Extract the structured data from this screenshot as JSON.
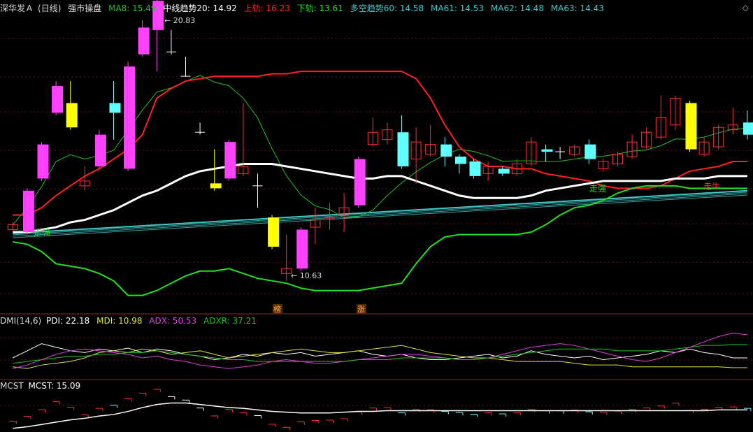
{
  "header": {
    "stock": "深华发Ａ",
    "period": "(日线)",
    "indicator": "强市操盘",
    "ma8": "MA8: 15.49",
    "mid": "中线趋势20: 14.92",
    "upper": "上轨: 16.23",
    "lower": "下轨: 13.61",
    "long": "多空趋势60: 14.58",
    "ma61": "MA61: 14.53",
    "ma62": "MA62: 14.48",
    "ma63": "MA63: 14.43"
  },
  "dmi_header": {
    "name": "DMI(14,6)",
    "pdi": "PDI: 22.18",
    "mdi": "MDI: 10.98",
    "adx": "ADX: 50.53",
    "adxr": "ADXR: 37.21"
  },
  "mcst_header": {
    "name": "MCST",
    "value": "MCST: 15.09"
  },
  "colors": {
    "upper_band": "#ff2020",
    "lower_band": "#20e020",
    "mid_line": "#ffffff",
    "ma8": "#20c020",
    "ma6x": "#40c8c8",
    "bull_candle": "#ff40ff",
    "yellow_candle": "#ffff00",
    "cyan_candle": "#60ffff",
    "red_candle": "#ff3030",
    "pdi": "#ffffff",
    "mdi": "#e0e040",
    "adx": "#e040e0",
    "adxr": "#20c020"
  },
  "annotations": {
    "high_price": "20.83",
    "low_price": "10.63",
    "signal_1": "走强",
    "signal_2": "走强",
    "signal_3": "走牛",
    "marker_1": "榜",
    "marker_2": "涨"
  },
  "chart_data": [
    {
      "type": "candlestick",
      "title": "强市操盘",
      "ylim": [
        9.5,
        21.5
      ],
      "candles": [
        {
          "o": 12.7,
          "c": 12.9,
          "h": 13.0,
          "l": 12.6,
          "s": "red"
        },
        {
          "o": 12.6,
          "c": 14.3,
          "h": 14.4,
          "l": 12.5,
          "s": "pink"
        },
        {
          "o": 14.8,
          "c": 16.2,
          "h": 16.3,
          "l": 14.7,
          "s": "pink"
        },
        {
          "o": 17.5,
          "c": 18.6,
          "h": 18.8,
          "l": 17.4,
          "s": "pink"
        },
        {
          "o": 17.9,
          "c": 16.9,
          "h": 18.8,
          "l": 16.8,
          "s": "yellow"
        },
        {
          "o": 14.5,
          "c": 14.7,
          "h": 15.3,
          "l": 14.3,
          "s": "red"
        },
        {
          "o": 15.3,
          "c": 16.6,
          "h": 16.8,
          "l": 15.2,
          "s": "pink"
        },
        {
          "o": 17.9,
          "c": 17.5,
          "h": 18.8,
          "l": 16.4,
          "s": "cyan"
        },
        {
          "o": 15.2,
          "c": 19.4,
          "h": 19.6,
          "l": 15.1,
          "s": "pink"
        },
        {
          "o": 19.9,
          "c": 21.0,
          "h": 21.3,
          "l": 19.8,
          "s": "pink"
        },
        {
          "o": 20.9,
          "c": 22.1,
          "h": 22.3,
          "l": 19.2,
          "s": "pink"
        },
        {
          "o": 20.0,
          "c": 20.0,
          "h": 20.9,
          "l": 19.9,
          "s": "doji"
        },
        {
          "o": 19.0,
          "c": 19.0,
          "h": 19.8,
          "l": 19.0,
          "s": "doji"
        },
        {
          "o": 16.7,
          "c": 16.7,
          "h": 17.1,
          "l": 16.6,
          "s": "doji"
        },
        {
          "o": 14.6,
          "c": 14.4,
          "h": 16.0,
          "l": 14.3,
          "s": "yellow"
        },
        {
          "o": 14.8,
          "c": 16.3,
          "h": 16.4,
          "l": 14.7,
          "s": "pink"
        },
        {
          "o": 15.0,
          "c": 15.3,
          "h": 17.9,
          "l": 14.9,
          "s": "red"
        },
        {
          "o": 14.5,
          "c": 14.5,
          "h": 15.0,
          "l": 13.6,
          "s": "doji"
        },
        {
          "o": 13.2,
          "c": 12.0,
          "h": 13.3,
          "l": 11.9,
          "s": "yellow"
        },
        {
          "o": 10.9,
          "c": 11.1,
          "h": 12.5,
          "l": 10.6,
          "s": "red"
        },
        {
          "o": 11.1,
          "c": 12.7,
          "h": 12.8,
          "l": 11.0,
          "s": "pink"
        },
        {
          "o": 12.8,
          "c": 13.1,
          "h": 13.6,
          "l": 12.1,
          "s": "red"
        },
        {
          "o": 13.2,
          "c": 13.2,
          "h": 13.8,
          "l": 12.7,
          "s": "red"
        },
        {
          "o": 13.3,
          "c": 13.6,
          "h": 14.2,
          "l": 12.6,
          "s": "red"
        },
        {
          "o": 13.7,
          "c": 15.6,
          "h": 15.7,
          "l": 13.6,
          "s": "pink"
        },
        {
          "o": 16.2,
          "c": 16.7,
          "h": 17.3,
          "l": 16.1,
          "s": "red"
        },
        {
          "o": 16.4,
          "c": 16.8,
          "h": 17.1,
          "l": 16.2,
          "s": "red"
        },
        {
          "o": 16.7,
          "c": 15.3,
          "h": 17.4,
          "l": 15.2,
          "s": "cyan"
        },
        {
          "o": 15.6,
          "c": 16.3,
          "h": 16.9,
          "l": 14.6,
          "s": "red"
        },
        {
          "o": 15.8,
          "c": 16.2,
          "h": 17.0,
          "l": 15.7,
          "s": "red"
        },
        {
          "o": 16.2,
          "c": 15.7,
          "h": 16.5,
          "l": 15.3,
          "s": "cyan"
        },
        {
          "o": 15.7,
          "c": 15.4,
          "h": 15.8,
          "l": 15.0,
          "s": "cyan"
        },
        {
          "o": 15.5,
          "c": 14.9,
          "h": 15.6,
          "l": 14.8,
          "s": "cyan"
        },
        {
          "o": 15.0,
          "c": 15.3,
          "h": 15.5,
          "l": 14.7,
          "s": "red"
        },
        {
          "o": 15.2,
          "c": 15.0,
          "h": 15.3,
          "l": 14.9,
          "s": "cyan"
        },
        {
          "o": 15.0,
          "c": 15.4,
          "h": 15.6,
          "l": 14.9,
          "s": "red"
        },
        {
          "o": 15.4,
          "c": 16.3,
          "h": 16.5,
          "l": 15.3,
          "s": "red"
        },
        {
          "o": 16.0,
          "c": 15.9,
          "h": 16.2,
          "l": 15.5,
          "s": "cyan"
        },
        {
          "o": 15.9,
          "c": 15.9,
          "h": 16.1,
          "l": 15.6,
          "s": "doji"
        },
        {
          "o": 15.8,
          "c": 16.1,
          "h": 16.2,
          "l": 15.7,
          "s": "red"
        },
        {
          "o": 16.2,
          "c": 15.6,
          "h": 16.4,
          "l": 15.4,
          "s": "cyan"
        },
        {
          "o": 15.2,
          "c": 15.5,
          "h": 15.6,
          "l": 15.1,
          "s": "red"
        },
        {
          "o": 15.4,
          "c": 15.8,
          "h": 15.9,
          "l": 15.3,
          "s": "red"
        },
        {
          "o": 15.7,
          "c": 16.3,
          "h": 16.6,
          "l": 15.6,
          "s": "red"
        },
        {
          "o": 16.1,
          "c": 16.7,
          "h": 16.9,
          "l": 16.0,
          "s": "red"
        },
        {
          "o": 16.5,
          "c": 17.3,
          "h": 18.2,
          "l": 16.4,
          "s": "red"
        },
        {
          "o": 17.0,
          "c": 18.1,
          "h": 18.2,
          "l": 16.8,
          "s": "red"
        },
        {
          "o": 17.9,
          "c": 16.0,
          "h": 18.0,
          "l": 15.9,
          "s": "yellow"
        },
        {
          "o": 15.8,
          "c": 16.3,
          "h": 16.5,
          "l": 15.7,
          "s": "red"
        },
        {
          "o": 16.1,
          "c": 16.9,
          "h": 17.0,
          "l": 16.0,
          "s": "red"
        },
        {
          "o": 16.8,
          "c": 17.0,
          "h": 17.7,
          "l": 16.6,
          "s": "red"
        },
        {
          "o": 17.1,
          "c": 16.6,
          "h": 17.6,
          "l": 16.4,
          "s": "cyan"
        }
      ],
      "series": [
        {
          "name": "上轨",
          "values": [
            13.3,
            13.3,
            13.6,
            14.1,
            14.5,
            14.9,
            15.2,
            15.6,
            16.0,
            16.6,
            18.1,
            18.5,
            18.8,
            18.9,
            19.0,
            19.0,
            19.0,
            19.0,
            19.1,
            19.1,
            19.2,
            19.2,
            19.2,
            19.2,
            19.2,
            19.2,
            19.2,
            19.2,
            18.9,
            18.1,
            17.0,
            16.1,
            15.6,
            15.3,
            15.3,
            15.2,
            15.2,
            15.0,
            14.9,
            14.8,
            14.7,
            14.5,
            14.4,
            14.4,
            14.4,
            14.5,
            14.8,
            15.1,
            15.2,
            15.3,
            15.5,
            15.5
          ]
        },
        {
          "name": "中线趋势20",
          "values": [
            12.6,
            12.6,
            12.7,
            12.8,
            13.0,
            13.1,
            13.3,
            13.5,
            13.8,
            14.1,
            14.3,
            14.6,
            14.9,
            15.1,
            15.2,
            15.3,
            15.4,
            15.4,
            15.4,
            15.3,
            15.2,
            15.1,
            15.0,
            14.9,
            14.8,
            14.8,
            14.9,
            14.9,
            14.7,
            14.5,
            14.3,
            14.1,
            14.0,
            14.0,
            14.0,
            14.0,
            14.1,
            14.3,
            14.4,
            14.5,
            14.6,
            14.7,
            14.7,
            14.7,
            14.7,
            14.7,
            14.8,
            14.8,
            14.8,
            14.9,
            14.9,
            14.9
          ]
        },
        {
          "name": "下轨",
          "values": [
            12.2,
            12.1,
            11.8,
            11.3,
            11.2,
            11.1,
            10.9,
            10.6,
            10.0,
            10.0,
            10.2,
            10.5,
            10.8,
            11.0,
            11.0,
            11.1,
            10.9,
            10.7,
            10.6,
            10.5,
            10.3,
            10.2,
            10.2,
            10.2,
            10.2,
            10.3,
            10.4,
            10.5,
            11.3,
            12.0,
            12.4,
            12.5,
            12.5,
            12.5,
            12.5,
            12.5,
            12.6,
            12.9,
            13.3,
            13.6,
            13.7,
            13.9,
            14.2,
            14.4,
            14.5,
            14.5,
            14.5,
            14.4,
            14.4,
            14.4,
            14.4,
            14.4
          ]
        }
      ]
    },
    {
      "type": "line",
      "title": "DMI(14,6)",
      "series": [
        {
          "name": "PDI",
          "values": [
            22,
            30,
            38,
            34,
            30,
            28,
            32,
            30,
            33,
            28,
            32,
            30,
            26,
            24,
            20,
            22,
            26,
            24,
            28,
            26,
            28,
            24,
            26,
            28,
            30,
            26,
            24,
            26,
            22,
            20,
            20,
            22,
            24,
            26,
            22,
            24,
            30,
            26,
            24,
            22,
            24,
            20,
            22,
            24,
            26,
            30,
            28,
            32,
            28,
            26,
            22,
            22
          ]
        },
        {
          "name": "MDI",
          "values": [
            12,
            10,
            14,
            16,
            18,
            22,
            28,
            30,
            28,
            32,
            30,
            26,
            28,
            30,
            26,
            22,
            24,
            26,
            28,
            30,
            32,
            30,
            28,
            28,
            30,
            32,
            34,
            36,
            32,
            28,
            26,
            24,
            22,
            22,
            20,
            18,
            18,
            18,
            18,
            16,
            14,
            14,
            14,
            12,
            12,
            12,
            12,
            12,
            12,
            12,
            11,
            11
          ]
        },
        {
          "name": "ADX",
          "values": [
            10,
            14,
            20,
            26,
            30,
            32,
            30,
            28,
            26,
            22,
            24,
            20,
            18,
            14,
            12,
            10,
            12,
            14,
            18,
            20,
            18,
            16,
            16,
            18,
            20,
            22,
            24,
            26,
            26,
            24,
            22,
            20,
            20,
            22,
            26,
            30,
            34,
            36,
            38,
            36,
            32,
            28,
            24,
            20,
            18,
            22,
            28,
            34,
            40,
            46,
            50,
            48
          ]
        },
        {
          "name": "ADXR",
          "values": [
            16,
            18,
            20,
            22,
            24,
            24,
            26,
            26,
            28,
            28,
            30,
            28,
            26,
            24,
            22,
            20,
            20,
            18,
            18,
            18,
            18,
            18,
            18,
            18,
            20,
            20,
            20,
            22,
            22,
            22,
            22,
            20,
            20,
            22,
            24,
            26,
            28,
            30,
            32,
            32,
            32,
            32,
            30,
            30,
            30,
            30,
            32,
            34,
            36,
            36,
            37,
            37
          ]
        }
      ]
    },
    {
      "type": "line",
      "title": "MCST",
      "series": [
        {
          "name": "MCST",
          "values": [
            12.7,
            12.9,
            13.2,
            13.5,
            13.8,
            14.0,
            14.3,
            14.5,
            14.9,
            15.4,
            15.8,
            16.0,
            16.0,
            15.8,
            15.6,
            15.4,
            15.3,
            15.1,
            14.9,
            14.8,
            14.7,
            14.7,
            14.7,
            14.8,
            14.9,
            14.9,
            15.0,
            15.0,
            15.0,
            15.0,
            15.0,
            15.0,
            15.0,
            15.0,
            15.0,
            15.0,
            15.0,
            15.0,
            15.0,
            15.0,
            15.0,
            15.0,
            15.0,
            15.0,
            15.0,
            15.0,
            15.0,
            15.0,
            15.0,
            15.1,
            15.1,
            15.1
          ]
        }
      ]
    }
  ]
}
